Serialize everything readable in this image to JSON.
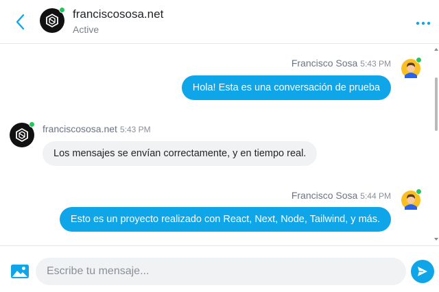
{
  "header": {
    "contact_name": "franciscososa.net",
    "contact_status": "Active"
  },
  "messages": [
    {
      "sender": "Francisco Sosa",
      "time": "5:43 PM",
      "text": "Hola! Esta es una conversación de prueba",
      "direction": "outgoing"
    },
    {
      "sender": "franciscososa.net",
      "time": "5:43 PM",
      "text": "Los mensajes se envían correctamente, y en tiempo real.",
      "direction": "incoming"
    },
    {
      "sender": "Francisco Sosa",
      "time": "5:44 PM",
      "text": "Esto es un proyecto realizado con React, Next, Node, Tailwind, y más.",
      "direction": "outgoing"
    }
  ],
  "composer": {
    "placeholder": "Escribe tu mensaje..."
  },
  "icons": {
    "back": "chevron-left-icon",
    "more": "more-horizontal-icon",
    "image": "image-icon",
    "send": "send-icon"
  },
  "colors": {
    "accent": "#0ea5e9",
    "online": "#22c55e",
    "incoming_bubble": "#f1f2f4"
  }
}
